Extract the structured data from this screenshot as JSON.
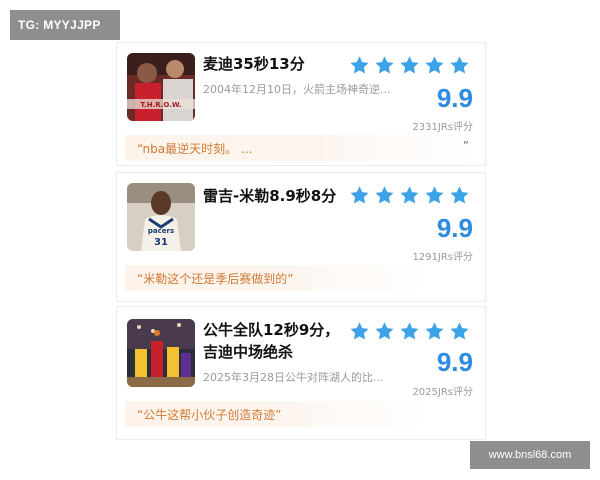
{
  "watermarks": {
    "top": "TG: MYYJJPP",
    "bottom": "www.bnsl68.com"
  },
  "colors": {
    "star": "#3ca3e8",
    "score": "#2d8be0",
    "quote_text": "#d17a35",
    "quote_bg": "#fdf3ea"
  },
  "cards": [
    {
      "title": "麦迪35秒13分",
      "subtitle": "2004年12月10日，火箭主场神奇逆...",
      "stars": 5,
      "score": "9.9",
      "rating_count": "2331JRs评分",
      "quote": "“nba最逆天时刻。 ...",
      "quote_close": "”",
      "thumb_icon": "player-photo-rockets",
      "thumb_text": "T.H.R.O.W."
    },
    {
      "title": "雷吉-米勒8.9秒8分",
      "subtitle": "",
      "stars": 5,
      "score": "9.9",
      "rating_count": "1291JRs评分",
      "quote": "“米勒这个还是季后赛做到的”",
      "thumb_icon": "player-photo-pacers",
      "thumb_text": "pacers",
      "thumb_number": "31"
    },
    {
      "title": "公牛全队12秒9分，吉迪中场绝杀",
      "title_line1": "公牛全队12秒9分，",
      "title_line2": "吉迪中场绝杀",
      "subtitle": "2025年3月28日公牛对阵湖人的比...",
      "stars": 5,
      "score": "9.9",
      "rating_count": "2025JRs评分",
      "quote": "“公牛这帮小伙子创造奇迹”",
      "thumb_icon": "game-photo-bulls-lakers"
    }
  ]
}
